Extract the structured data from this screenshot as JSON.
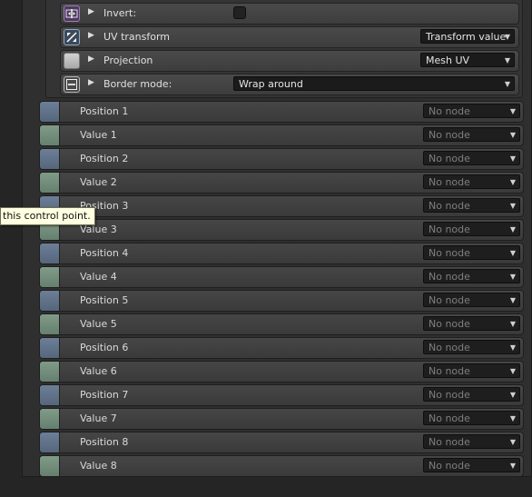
{
  "properties": [
    {
      "label": "Invert:",
      "icon": "invert-icon",
      "control": "checkbox"
    },
    {
      "label": "UV transform",
      "icon": "uv-transform-icon",
      "control": "dropdown",
      "value": "Transform value"
    },
    {
      "label": "Projection",
      "icon": "projection-icon",
      "control": "dropdown",
      "value": "Mesh UV"
    },
    {
      "label": "Border mode:",
      "icon": "border-mode-icon",
      "control": "dropdown",
      "value": "Wrap around"
    }
  ],
  "rows": [
    {
      "label": "Position 1",
      "value": "No node",
      "socket": "blue"
    },
    {
      "label": "Value 1",
      "value": "No node",
      "socket": "green"
    },
    {
      "label": "Position 2",
      "value": "No node",
      "socket": "blue"
    },
    {
      "label": "Value 2",
      "value": "No node",
      "socket": "green"
    },
    {
      "label": "Position 3",
      "value": "No node",
      "socket": "blue"
    },
    {
      "label": "Value 3",
      "value": "No node",
      "socket": "green"
    },
    {
      "label": "Position 4",
      "value": "No node",
      "socket": "blue"
    },
    {
      "label": "Value 4",
      "value": "No node",
      "socket": "green"
    },
    {
      "label": "Position 5",
      "value": "No node",
      "socket": "blue"
    },
    {
      "label": "Value 5",
      "value": "No node",
      "socket": "green"
    },
    {
      "label": "Position 6",
      "value": "No node",
      "socket": "blue"
    },
    {
      "label": "Value 6",
      "value": "No node",
      "socket": "green"
    },
    {
      "label": "Position 7",
      "value": "No node",
      "socket": "blue"
    },
    {
      "label": "Value 7",
      "value": "No node",
      "socket": "green"
    },
    {
      "label": "Position 8",
      "value": "No node",
      "socket": "blue"
    },
    {
      "label": "Value 8",
      "value": "No node",
      "socket": "green"
    }
  ],
  "tooltip": {
    "text": "this control point."
  },
  "colors": {
    "socket_blue": "#62748b",
    "socket_green": "#758f7c",
    "tooltip_bg": "#ffffe1"
  }
}
